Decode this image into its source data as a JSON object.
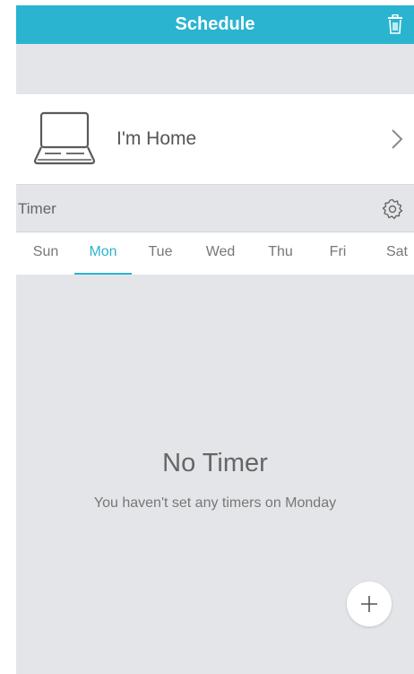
{
  "header": {
    "title": "Schedule",
    "delete_icon": "trash-icon"
  },
  "device": {
    "name": "I'm Home",
    "icon": "laptop-icon"
  },
  "timer_section": {
    "label": "Timer",
    "settings_icon": "gear-icon"
  },
  "days": {
    "items": [
      "Sun",
      "Mon",
      "Tue",
      "Wed",
      "Thu",
      "Fri",
      "Sat"
    ],
    "selected": "Mon"
  },
  "empty_state": {
    "title": "No Timer",
    "message": "You haven't set any timers on Monday"
  },
  "fab": {
    "icon": "plus-icon"
  },
  "colors": {
    "accent": "#2ab4d0",
    "background": "#e4e5e9"
  }
}
